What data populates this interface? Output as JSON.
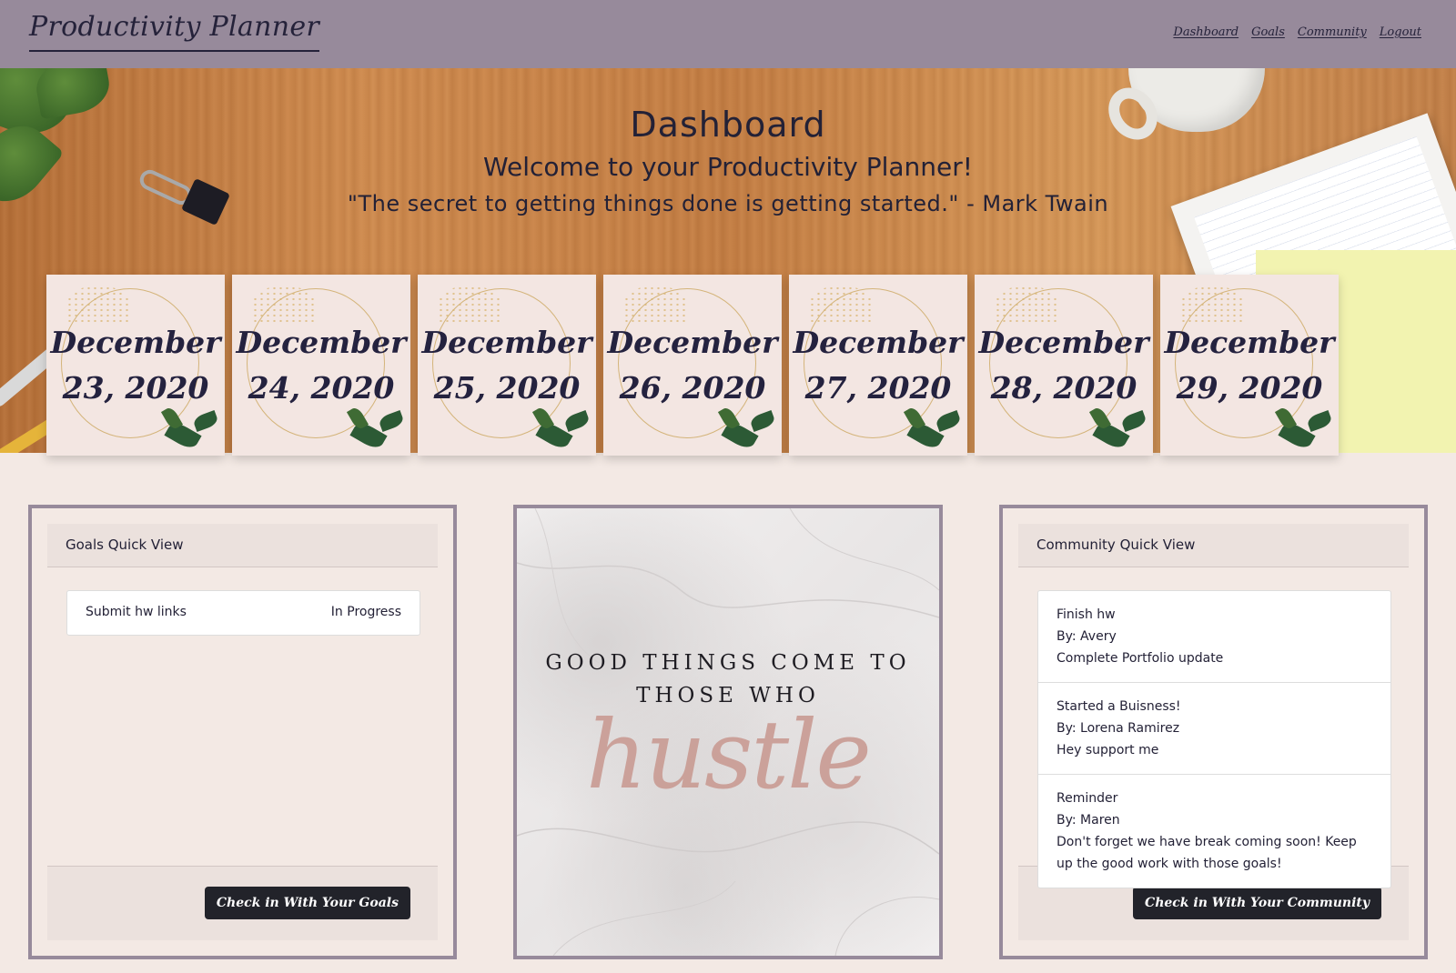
{
  "nav": {
    "brand": "Productivity Planner",
    "links": [
      "Dashboard",
      "Goals",
      "Community",
      "Logout"
    ]
  },
  "hero": {
    "title": "Dashboard",
    "welcome": "Welcome to your Productivity Planner!",
    "quote": "\"The secret to getting things done is getting started.\" - Mark Twain"
  },
  "dates": [
    {
      "month": "December",
      "day": "23, 2020"
    },
    {
      "month": "December",
      "day": "24, 2020"
    },
    {
      "month": "December",
      "day": "25, 2020"
    },
    {
      "month": "December",
      "day": "26, 2020"
    },
    {
      "month": "December",
      "day": "27, 2020"
    },
    {
      "month": "December",
      "day": "28, 2020"
    },
    {
      "month": "December",
      "day": "29, 2020"
    }
  ],
  "goals": {
    "header": "Goals Quick View",
    "items": [
      {
        "name": "Submit hw links",
        "status": "In Progress"
      }
    ],
    "button": "Check in With Your Goals"
  },
  "motivation": {
    "line1": "GOOD THINGS COME TO",
    "line2": "THOSE WHO",
    "script": "hustle"
  },
  "community": {
    "header": "Community Quick View",
    "posts": [
      {
        "title": "Finish hw",
        "author": "By: Avery",
        "body": "Complete Portfolio update"
      },
      {
        "title": "Started a Buisness!",
        "author": "By: Lorena Ramirez",
        "body": "Hey support me"
      },
      {
        "title": "Reminder",
        "author": "By: Maren",
        "body": "Don't forget we have break coming soon! Keep up the good work with those goals!"
      }
    ],
    "button": "Check in With Your Community"
  },
  "colors": {
    "nav_bg": "#978a9b",
    "page_bg": "#f3e9e4",
    "button_bg": "#22232a",
    "text": "#232136"
  }
}
